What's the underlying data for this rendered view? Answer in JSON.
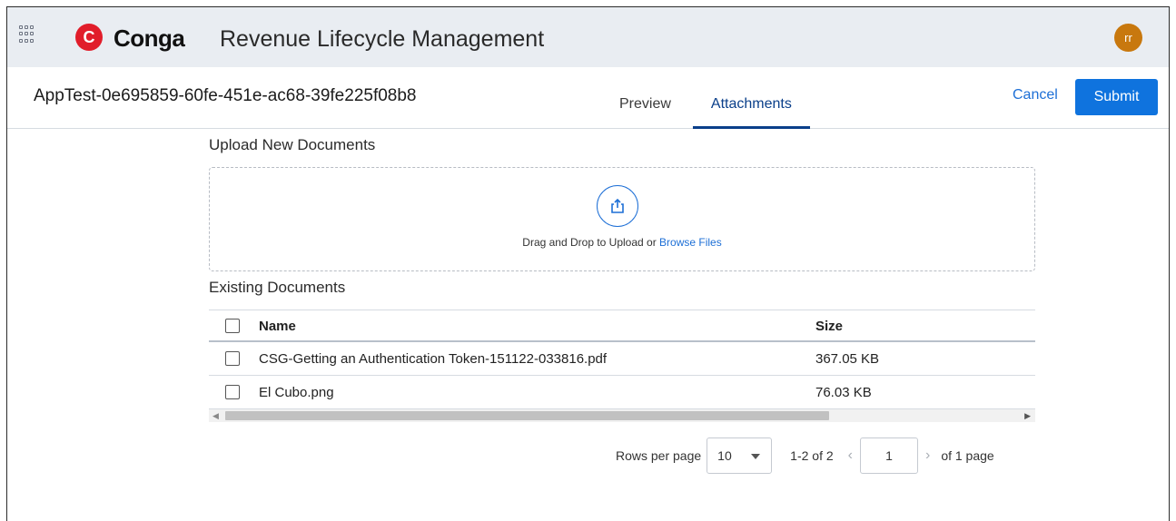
{
  "header": {
    "logo_letter": "C",
    "brand": "Conga",
    "product": "Revenue Lifecycle Management",
    "avatar_initials": "rr"
  },
  "record": {
    "title": "AppTest-0e695859-60fe-451e-ac68-39fe225f08b8"
  },
  "tabs": [
    {
      "label": "Preview",
      "active": false
    },
    {
      "label": "Attachments",
      "active": true
    }
  ],
  "actions": {
    "cancel_label": "Cancel",
    "submit_label": "Submit"
  },
  "upload": {
    "section_title": "Upload New Documents",
    "drop_text": "Drag and Drop to Upload or ",
    "browse_label": "Browse Files"
  },
  "existing": {
    "section_title": "Existing Documents",
    "columns": {
      "name": "Name",
      "size": "Size"
    },
    "rows": [
      {
        "name": "CSG-Getting an Authentication Token-151122-033816.pdf",
        "size": "367.05 KB"
      },
      {
        "name": "El Cubo.png",
        "size": "76.03 KB"
      }
    ]
  },
  "pagination": {
    "rows_per_page_label": "Rows per page",
    "rows_per_page_value": "10",
    "range_text": "1-2 of 2",
    "current_page": "1",
    "of_pages_text": "of 1 page"
  },
  "colors": {
    "accent": "#0f73de",
    "active_tab": "#0a3f8a",
    "logo_red": "#e11d2a",
    "avatar": "#c8780e",
    "header_bg": "#e9edf2"
  }
}
